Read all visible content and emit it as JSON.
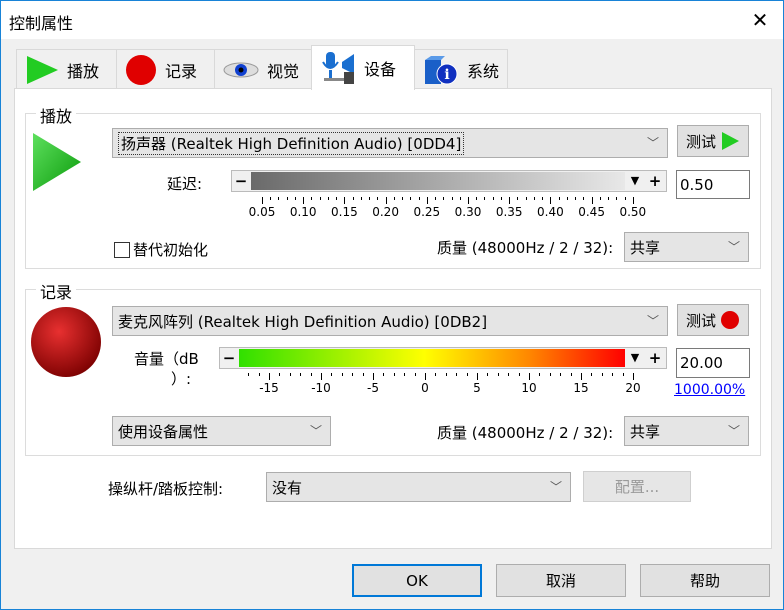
{
  "window": {
    "title": "控制属性",
    "close_icon": "close-icon"
  },
  "tabs": [
    {
      "label": "播放",
      "icon": "play-icon"
    },
    {
      "label": "记录",
      "icon": "record-icon"
    },
    {
      "label": "视觉",
      "icon": "eye-icon"
    },
    {
      "label": "设备",
      "icon": "device-icon",
      "active": true
    },
    {
      "label": "系统",
      "icon": "system-info-icon"
    }
  ],
  "playback": {
    "group_label": "播放",
    "device": "扬声器 (Realtek High Definition Audio) [0DD4]",
    "test_label": "测试",
    "latency_label": "延迟:",
    "latency_value": "0.50",
    "latency_ticks": [
      "0.05",
      "0.10",
      "0.15",
      "0.20",
      "0.25",
      "0.30",
      "0.35",
      "0.40",
      "0.45",
      "0.50"
    ],
    "alt_init_label": "替代初始化",
    "alt_init_checked": false,
    "quality_label": "质量 (48000Hz / 2 / 32):",
    "quality_value": "共享"
  },
  "record": {
    "group_label": "记录",
    "device": "麦克风阵列 (Realtek High Definition Audio) [0DB2]",
    "test_label": "测试",
    "volume_label_1": "音量（dB",
    "volume_label_2": "）:",
    "volume_value": "20.00",
    "volume_percent": "1000.00%",
    "volume_ticks": [
      "-15",
      "-10",
      "-5",
      "0",
      "5",
      "10",
      "15",
      "20"
    ],
    "props_value": "使用设备属性",
    "quality_label": "质量 (48000Hz / 2 / 32):",
    "quality_value": "共享"
  },
  "joystick": {
    "label": "操纵杆/踏板控制:",
    "value": "没有",
    "config_label": "配置..."
  },
  "buttons": {
    "ok": "OK",
    "cancel": "取消",
    "help": "帮助"
  },
  "colors": {
    "accent": "#1883d7",
    "link": "#0000ff"
  }
}
